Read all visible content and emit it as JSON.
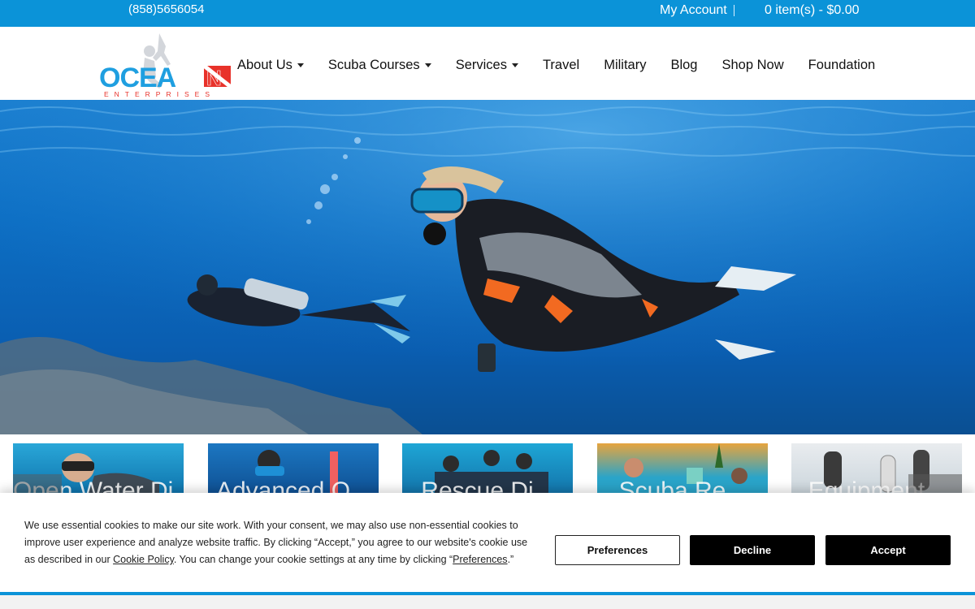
{
  "topbar": {
    "phone": "(858)5656054",
    "account": "My Account",
    "cart": "0 item(s) - $0.00"
  },
  "logo": {
    "word": "OCEAN",
    "tagline": "ENTERPRISES"
  },
  "nav": [
    {
      "label": "About Us",
      "dropdown": true
    },
    {
      "label": "Scuba Courses",
      "dropdown": true
    },
    {
      "label": "Services",
      "dropdown": true
    },
    {
      "label": "Travel",
      "dropdown": false
    },
    {
      "label": "Military",
      "dropdown": false
    },
    {
      "label": "Blog",
      "dropdown": false
    },
    {
      "label": "Shop Now",
      "dropdown": false
    },
    {
      "label": "Foundation",
      "dropdown": false
    }
  ],
  "thumbnails": [
    {
      "caption": "Open Water Di..."
    },
    {
      "caption": "Advanced O..."
    },
    {
      "caption": "Rescue Di..."
    },
    {
      "caption": "Scuba Re..."
    },
    {
      "caption": "Equipment..."
    }
  ],
  "cookie": {
    "text_before": "We use essential cookies to make our site work. With your consent, we may also use non-essential cookies to improve user experience and analyze website traffic. By clicking “Accept,” you agree to our website's cookie use as described in our ",
    "policy_link": "Cookie Policy",
    "text_middle": ". You can change your cookie settings at any time by clicking “",
    "pref_link": "Preferences",
    "text_after": ".”",
    "preferences_label": "Preferences",
    "decline_label": "Decline",
    "accept_label": "Accept"
  },
  "colors": {
    "brand_blue": "#0b93d8",
    "logo_red": "#e8322a",
    "button_black": "#000000"
  }
}
